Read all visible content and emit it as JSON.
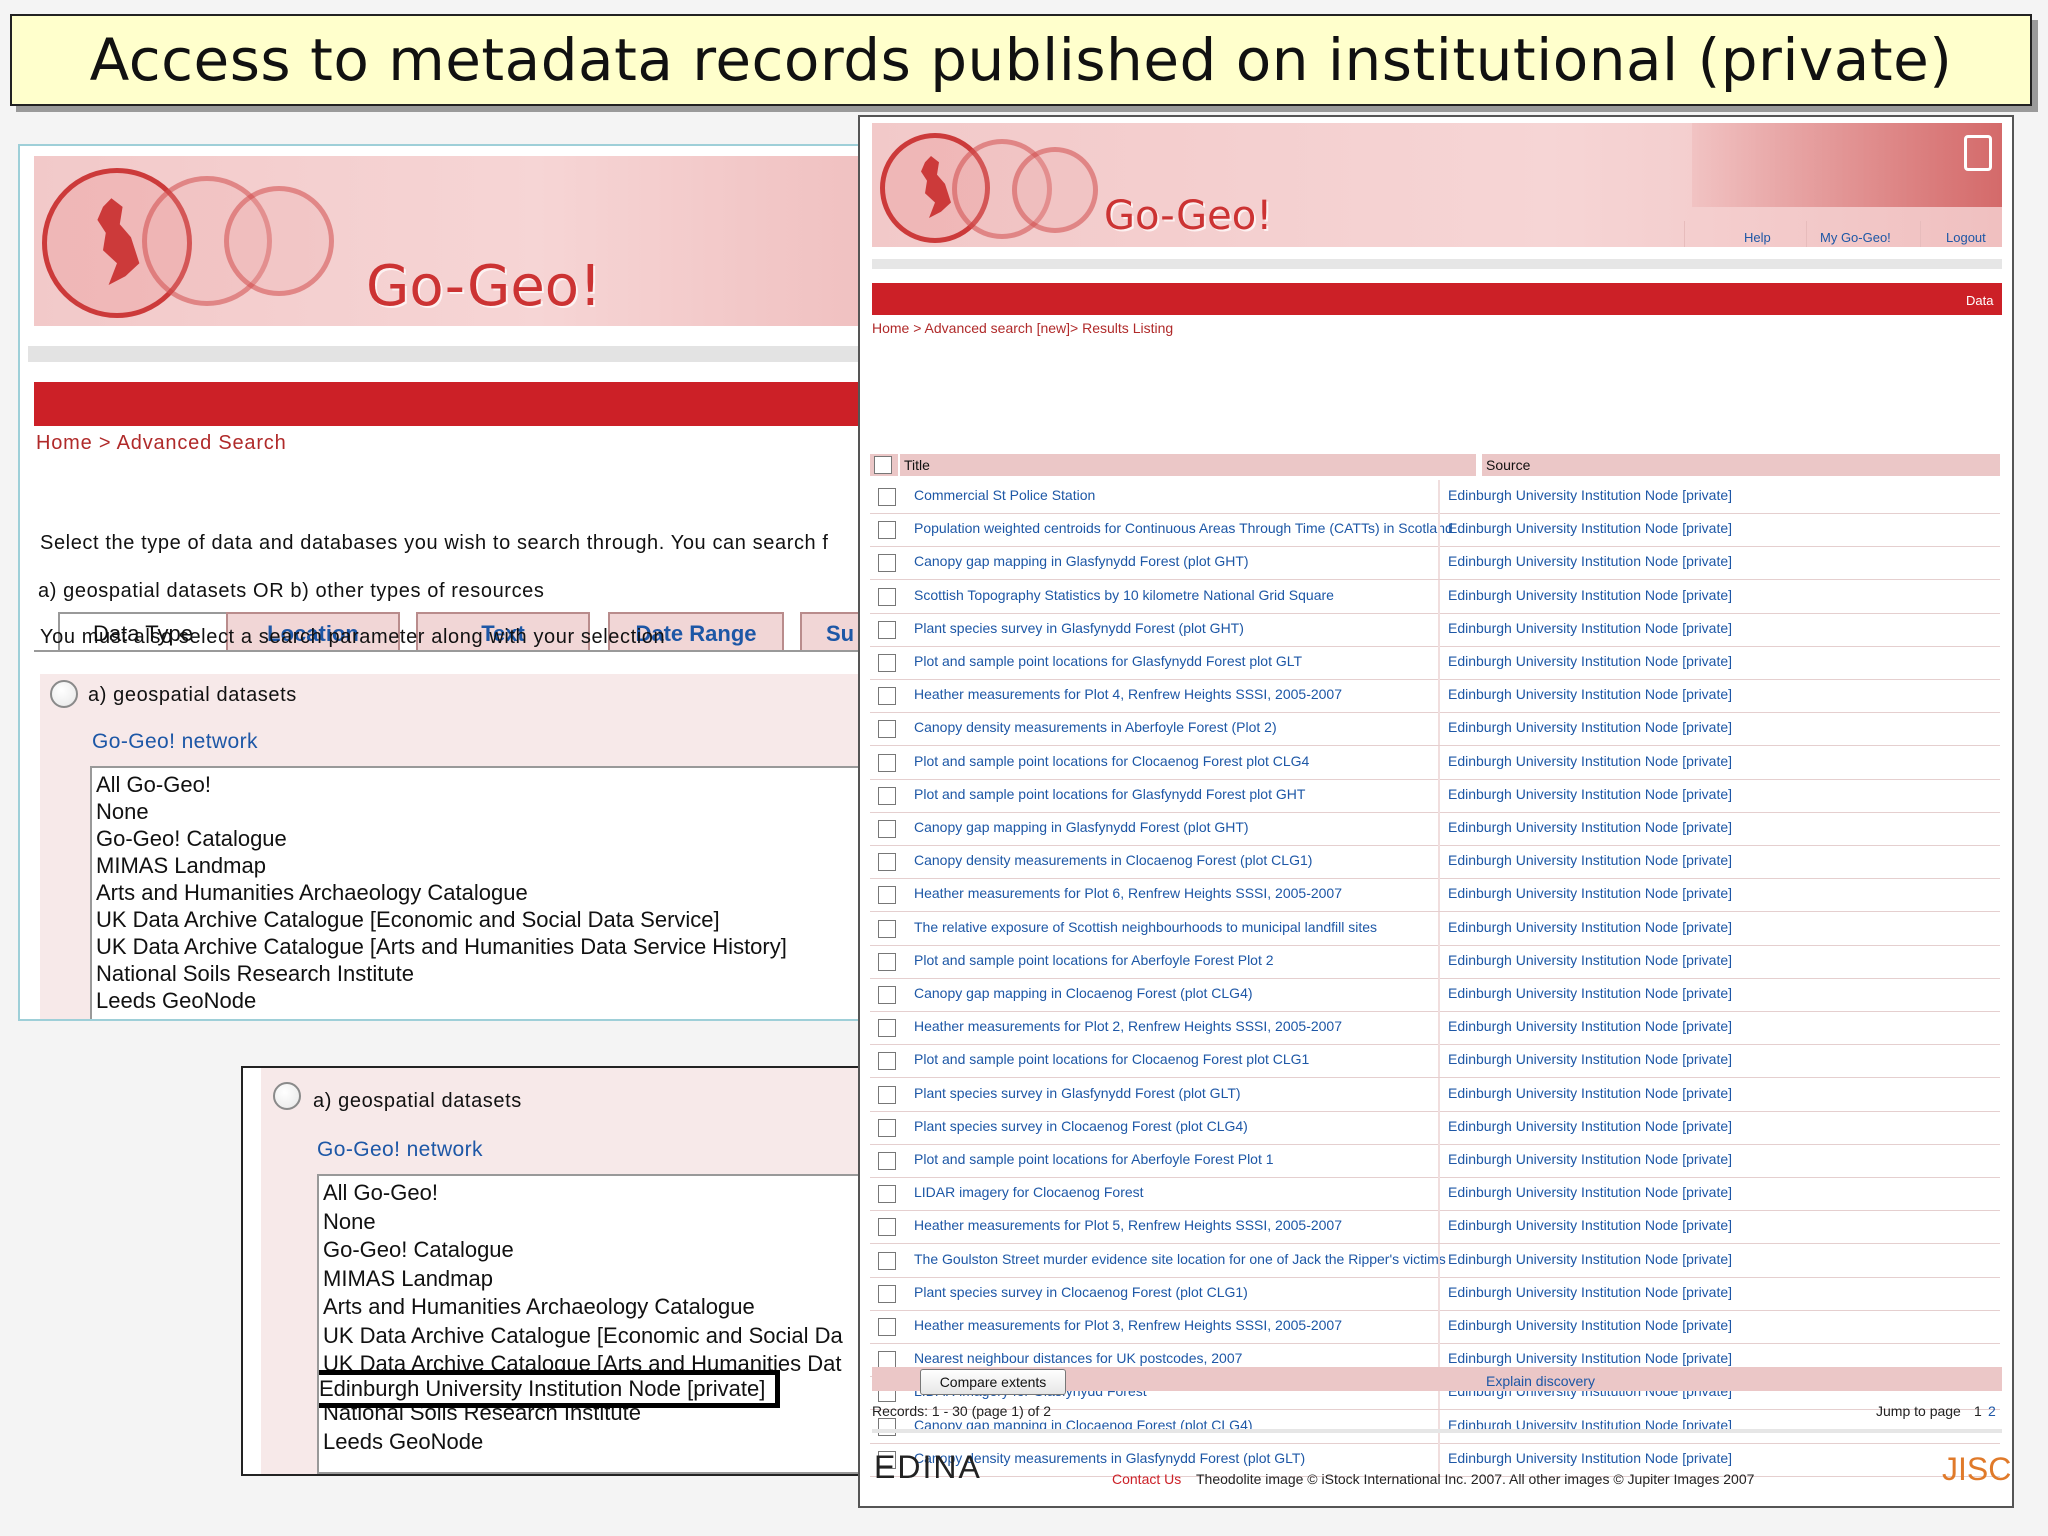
{
  "slide_title": "Access to metadata records published on institutional (private) node",
  "left_panel": {
    "logo": "Go-Geo!",
    "breadcrumb": "Home > Advanced Search",
    "tabs": [
      "Data Type",
      "Location",
      "Text",
      "Date Range",
      "Su"
    ],
    "intro_1": "Select the type of data and databases you wish to search through. You can search f",
    "intro_2": "a) geospatial datasets OR b) other types of resources",
    "intro_3": "You must also select a search parameter along with your selection",
    "option_label": "a) geospatial datasets",
    "network_label": "Go-Geo! network",
    "list_items": [
      "All Go-Geo!",
      "None",
      "Go-Geo! Catalogue",
      "MIMAS Landmap",
      "Arts and Humanities Archaeology Catalogue",
      "UK Data Archive Catalogue [Economic and Social Data Service]",
      "UK Data Archive Catalogue [Arts and Humanities Data Service History]",
      "National Soils Research Institute",
      "Leeds GeoNode"
    ]
  },
  "inset_panel": {
    "option_label": "a) geospatial datasets",
    "network_label": "Go-Geo! network",
    "list_items": [
      "All Go-Geo!",
      "None",
      "Go-Geo! Catalogue",
      "MIMAS Landmap",
      "Arts and Humanities Archaeology Catalogue",
      "UK Data Archive Catalogue [Economic and Social Da",
      "UK Data Archive Catalogue [Arts and Humanities Dat"
    ],
    "highlighted_item": "Edinburgh University Institution Node [private]",
    "after_items": [
      "National Soils Research Institute",
      "Leeds GeoNode"
    ]
  },
  "right_panel": {
    "logo": "Go-Geo!",
    "nav": [
      "Help",
      "My Go-Geo!",
      "Logout"
    ],
    "red_bar_label": "Data",
    "breadcrumb": "Home > Advanced search [new]> Results Listing",
    "col_title": "Title",
    "col_source": "Source",
    "source_value": "Edinburgh University Institution Node [private]",
    "rows": [
      "Commercial St Police Station",
      "Population weighted centroids for Continuous Areas Through Time (CATTs) in Scotland",
      "Canopy gap mapping in Glasfynydd Forest (plot GHT)",
      "Scottish Topography Statistics by 10 kilometre National Grid Square",
      "Plant species survey in Glasfynydd Forest (plot GHT)",
      "Plot and sample point locations for Glasfynydd Forest plot GLT",
      "Heather measurements for Plot 4, Renfrew Heights SSSI, 2005-2007",
      "Canopy density measurements in Aberfoyle Forest (Plot 2)",
      "Plot and sample point locations for Clocaenog Forest plot CLG4",
      "Plot and sample point locations for Glasfynydd Forest plot GHT",
      "Canopy gap mapping in Glasfynydd Forest (plot GHT)",
      "Canopy density measurements in Clocaenog Forest (plot CLG1)",
      "Heather measurements for Plot 6, Renfrew Heights SSSI, 2005-2007",
      "The relative exposure of Scottish neighbourhoods to municipal landfill sites",
      "Plot and sample point locations for Aberfoyle Forest Plot 2",
      "Canopy gap mapping in Clocaenog Forest (plot CLG4)",
      "Heather measurements for Plot 2, Renfrew Heights SSSI, 2005-2007",
      "Plot and sample point locations for Clocaenog Forest plot CLG1",
      "Plant species survey in Glasfynydd Forest (plot GLT)",
      "Plant species survey in Clocaenog Forest (plot CLG4)",
      "Plot and sample point locations for Aberfoyle Forest Plot 1",
      "LIDAR imagery for Clocaenog Forest",
      "Heather measurements for Plot 5, Renfrew Heights SSSI, 2005-2007",
      "The Goulston Street murder evidence site location for one of Jack the Ripper's victims",
      "Plant species survey in Clocaenog Forest (plot CLG1)",
      "Heather measurements for Plot 3, Renfrew Heights SSSI, 2005-2007",
      "Nearest neighbour distances for UK postcodes, 2007",
      "LIDAR imagery for Glasfynydd Forest",
      "Canopy gap mapping in Clocaenog Forest (plot CLG4)",
      "Canopy density measurements in Glasfynydd Forest (plot GLT)"
    ],
    "compare_button": "Compare extents",
    "explain_link": "Explain discovery",
    "records": "Records: 1 - 30 (page 1) of 2",
    "jump_label": "Jump to page",
    "pages": [
      "1",
      "2"
    ],
    "edina": "EDINA",
    "contact": "Contact Us",
    "credits": "Theodolite image © iStock International Inc. 2007. All other images © Jupiter Images 2007",
    "jisc": "JISC"
  }
}
